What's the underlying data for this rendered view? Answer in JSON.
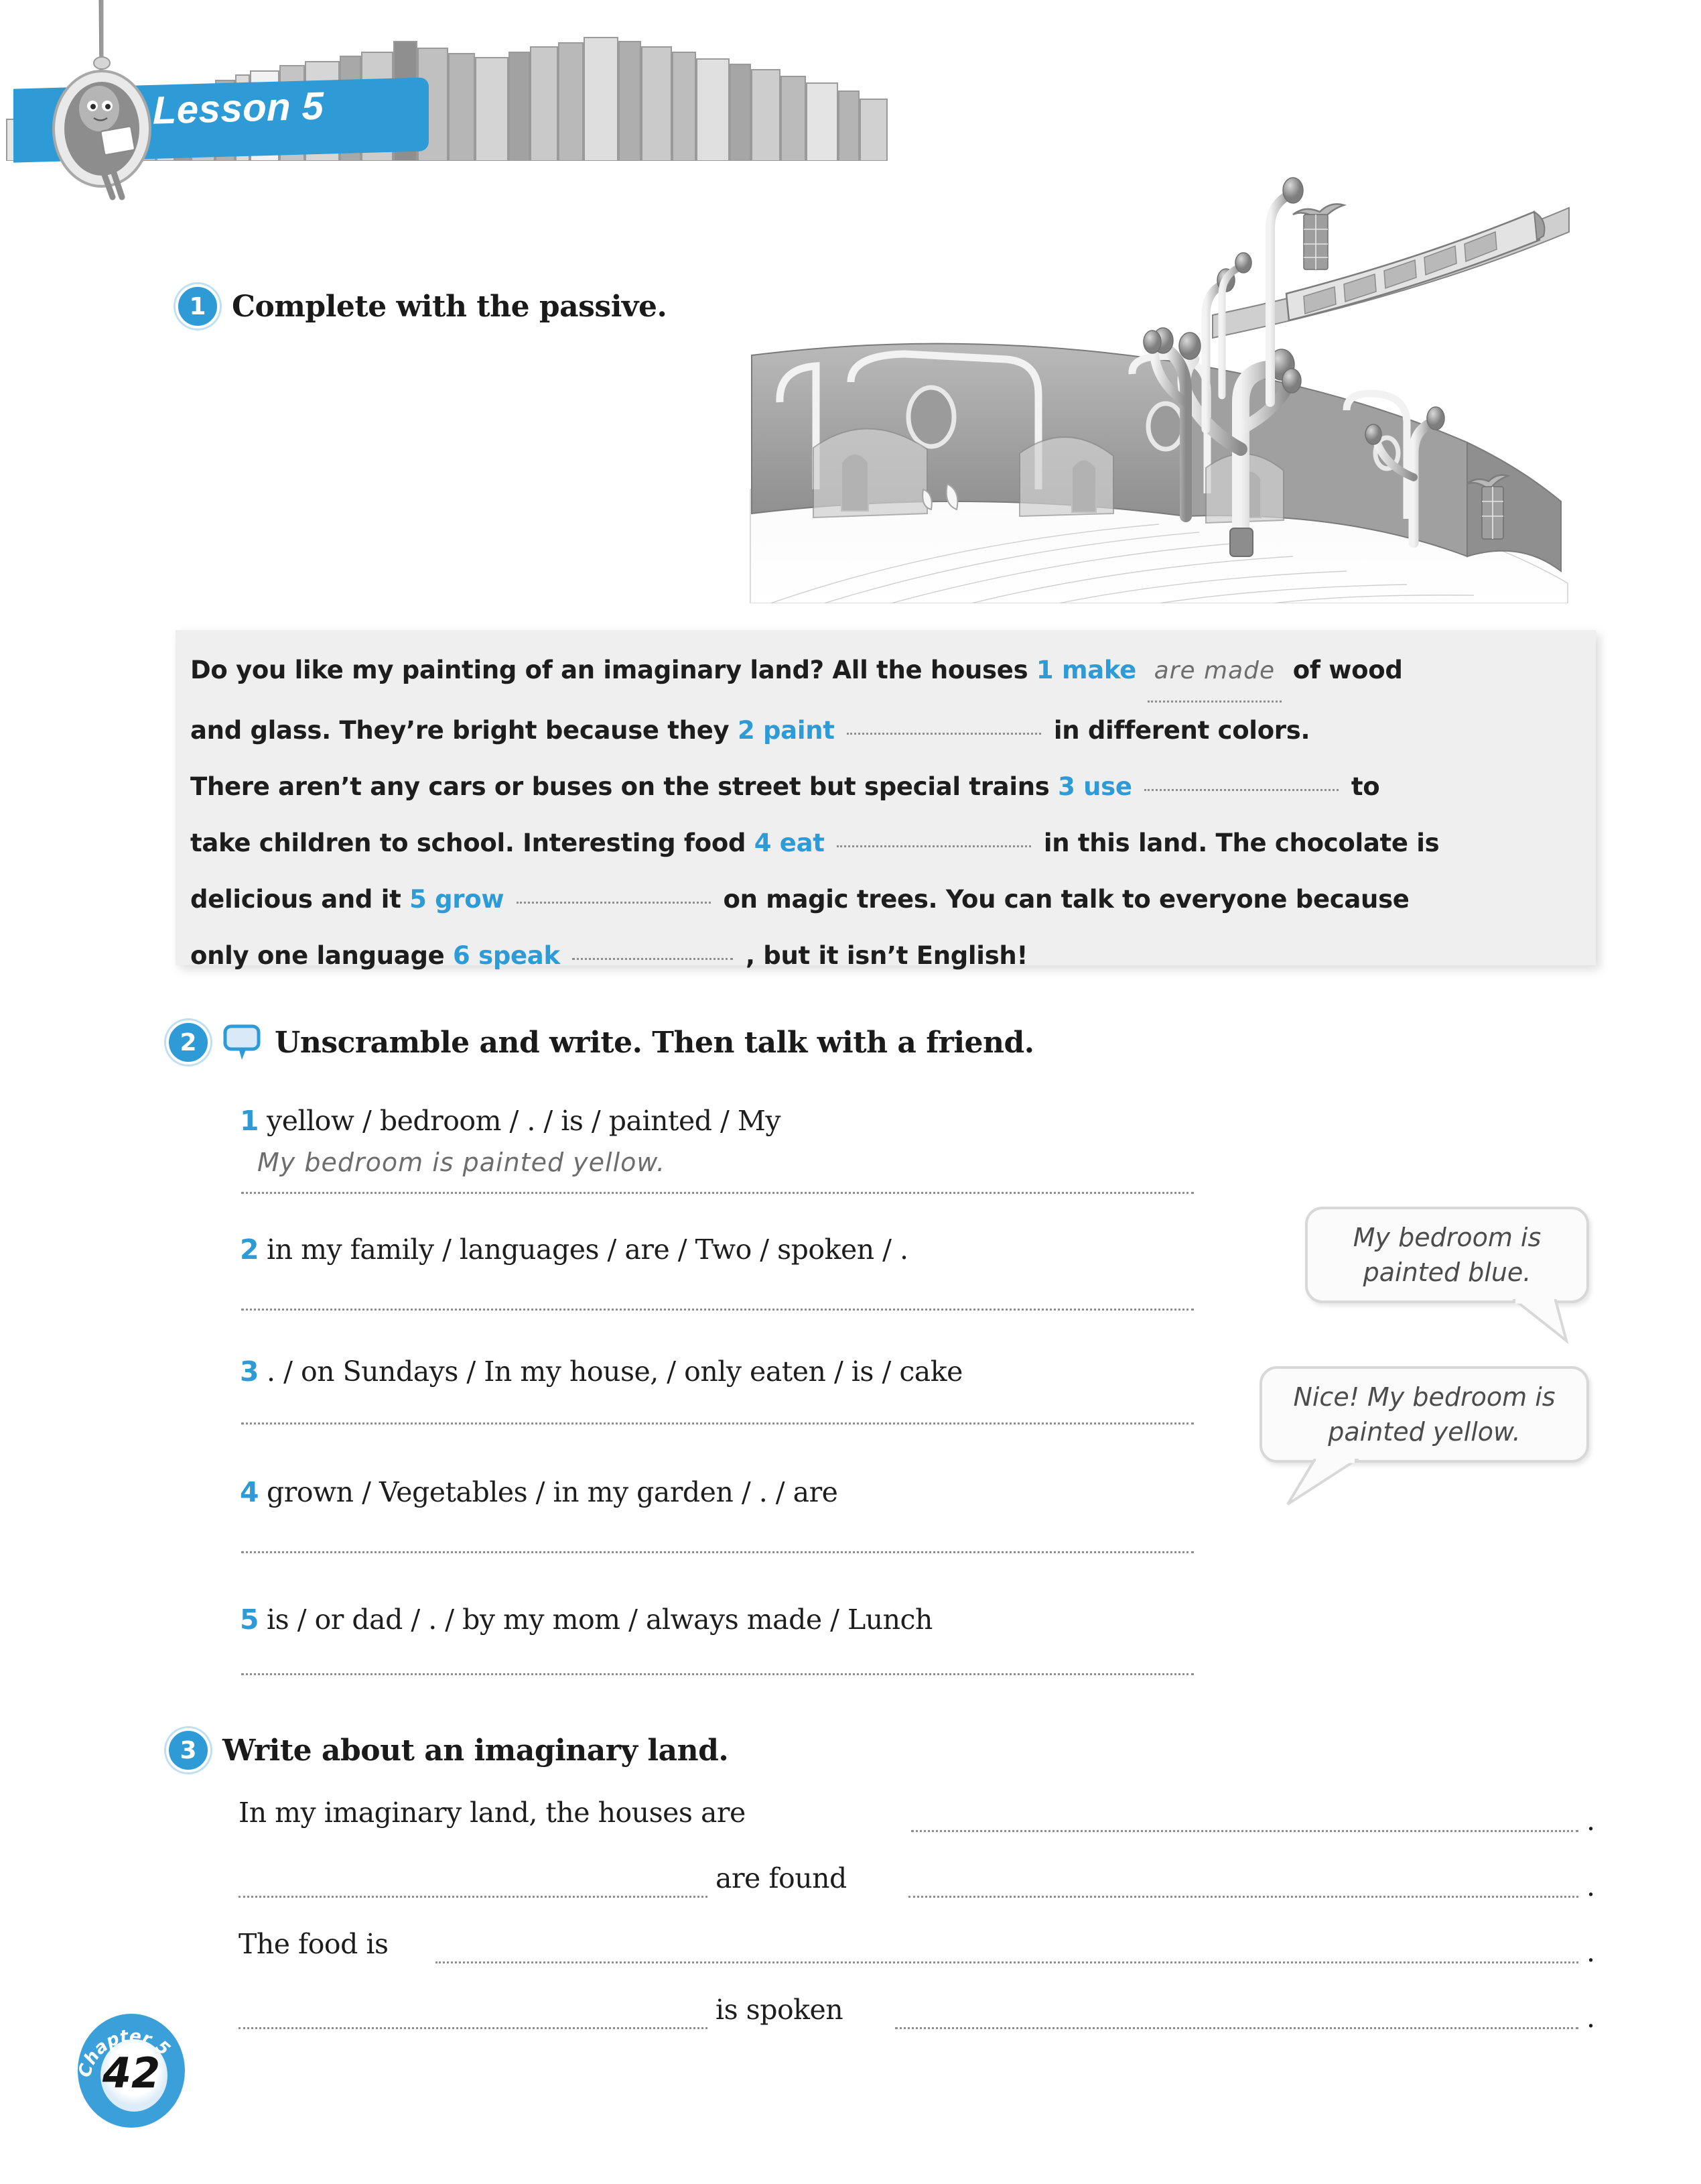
{
  "banner": {
    "lesson_label": "Lesson 5",
    "accent_color": "#2e9bd6",
    "shelf_icon": "bookshelf-icon",
    "chair_icon": "hanging-chair-girl-icon"
  },
  "illustration": {
    "name": "imaginary-land-pencil-sketch",
    "description": "Pencil sketch of a futuristic street with curved buildings, lollipop trees and a monorail train"
  },
  "exercises": [
    {
      "number": "1",
      "title": "Complete with the passive.",
      "paragraph": {
        "s1a": "Do you like my painting of an imaginary land? All the houses",
        "cue1_num": "1",
        "cue1": "make",
        "answer1": "are made",
        "s1b": "of wood",
        "s2a": "and glass. They’re bright because they",
        "cue2_num": "2",
        "cue2": "paint",
        "s2b": "in different colors.",
        "s3a": "There aren’t any cars or buses on the street but special trains",
        "cue3_num": "3",
        "cue3": "use",
        "s3b": "to",
        "s4a": "take children to school. Interesting food",
        "cue4_num": "4",
        "cue4": "eat",
        "s4b": "in this land. The chocolate is",
        "s5a": "delicious and it",
        "cue5_num": "5",
        "cue5": "grow",
        "s5b": "on magic trees. You can talk to everyone because",
        "s6a": "only one language",
        "cue6_num": "6",
        "cue6": "speak",
        "s6b": ", but it isn’t English!"
      }
    },
    {
      "number": "2",
      "title": "Unscramble and write. Then talk with a friend.",
      "icon": "speech-bubble-icon",
      "items": [
        {
          "num": "1",
          "text": "yellow / bedroom / . / is / painted / My",
          "answer": "My bedroom is painted yellow."
        },
        {
          "num": "2",
          "text": "in my family / languages / are / Two / spoken / .",
          "answer": ""
        },
        {
          "num": "3",
          "text": ". / on Sundays / In my house, / only eaten / is / cake",
          "answer": ""
        },
        {
          "num": "4",
          "text": "grown / Vegetables / in my garden / . / are",
          "answer": ""
        },
        {
          "num": "5",
          "text": "is / or dad / . / by my mom / always made / Lunch",
          "answer": ""
        }
      ],
      "speech_bubbles": [
        {
          "text": "My bedroom is painted blue."
        },
        {
          "text": "Nice! My bedroom is painted yellow."
        }
      ]
    },
    {
      "number": "3",
      "title": "Write about an imaginary land.",
      "lines": [
        {
          "lead": "In my imaginary land, the houses are",
          "tail": "."
        },
        {
          "mid": "are found",
          "tail": "."
        },
        {
          "lead": "The food is",
          "tail": "."
        },
        {
          "mid": "is spoken",
          "tail": "."
        }
      ]
    }
  ],
  "footer": {
    "chapter_label": "Chapter 5",
    "page_number": "42"
  }
}
